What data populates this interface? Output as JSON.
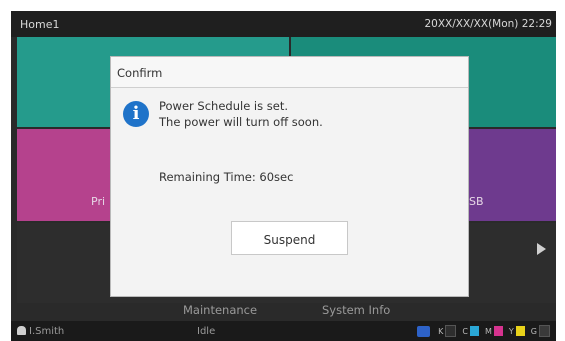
{
  "header": {
    "title": "Home1",
    "datetime": "20XX/XX/XX(Mon) 22:29"
  },
  "tiles": {
    "print_label": "Pri",
    "usb_label": "SB"
  },
  "bottom_nav": {
    "maintenance": "Maintenance",
    "system_info": "System Info"
  },
  "status": {
    "user": "I.Smith",
    "state": "Idle",
    "toner": [
      {
        "label": "K",
        "color": "#2e2e2e"
      },
      {
        "label": "C",
        "color": "#2aa7d6"
      },
      {
        "label": "M",
        "color": "#d6338f"
      },
      {
        "label": "Y",
        "color": "#e8d21a"
      },
      {
        "label": "G",
        "color": "#3a3a3a"
      }
    ]
  },
  "dialog": {
    "title": "Confirm",
    "message_line1": "Power Schedule is set.",
    "message_line2": "The power will turn off soon.",
    "remaining": "Remaining Time: 60sec",
    "suspend_label": "Suspend"
  },
  "colors": {
    "accent": "#1f73c9",
    "teal": "#259b8c",
    "magenta": "#b5428d",
    "purple": "#6e3a8e"
  }
}
